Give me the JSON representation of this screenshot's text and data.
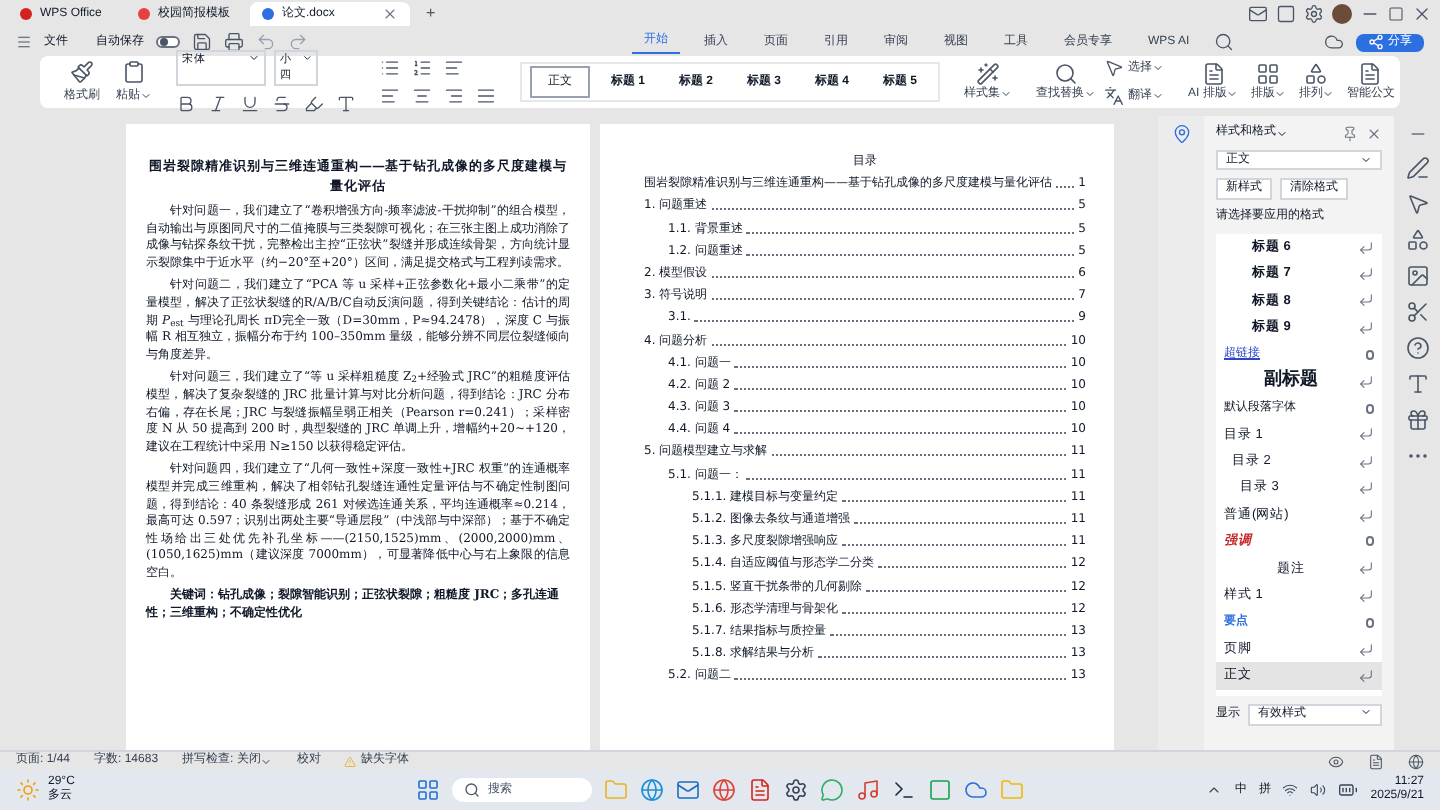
{
  "title_bar": {
    "tabs": [
      {
        "label": "WPS Office",
        "selected": false,
        "kind": "home"
      },
      {
        "label": "校园简报模板",
        "selected": false,
        "kind": "pdf"
      },
      {
        "label": "论文.docx",
        "selected": true,
        "kind": "doc"
      }
    ],
    "new_tab": "+"
  },
  "menu_bar": {
    "file": "文件",
    "autosave": {
      "label": "自动保存",
      "on": false
    },
    "tabs": [
      {
        "label": "开始",
        "selected": true
      },
      {
        "label": "插入",
        "selected": false
      },
      {
        "label": "页面",
        "selected": false
      },
      {
        "label": "引用",
        "selected": false
      },
      {
        "label": "审阅",
        "selected": false
      },
      {
        "label": "视图",
        "selected": false
      },
      {
        "label": "工具",
        "selected": false
      },
      {
        "label": "会员专享",
        "selected": false
      },
      {
        "label": "WPS AI",
        "selected": false
      }
    ],
    "share": "分享"
  },
  "ribbon": {
    "clipboard": [
      "格式刷",
      "粘贴"
    ],
    "font": {
      "name": "宋体",
      "size": "小四"
    },
    "styles": [
      {
        "label": "正文",
        "selected": true
      },
      {
        "label": "标题 1",
        "selected": false
      },
      {
        "label": "标题 2",
        "selected": false
      },
      {
        "label": "标题 3",
        "selected": false
      },
      {
        "label": "标题 4",
        "selected": false
      },
      {
        "label": "标题 5",
        "selected": false
      }
    ],
    "style_set": "样式集",
    "find": "查找替换",
    "select": "选择",
    "translate": "翻译",
    "tools": [
      "AI 排版",
      "排版",
      "排列"
    ],
    "smart_doc": "智能公文"
  },
  "page": {
    "title": "围岩裂隙精准识别与三维连通重构——基于钻孔成像的多尺度建模与量化评估",
    "paragraphs": [
      "针对问题一，我们建立了“卷积增强方向-频率滤波-干扰抑制”的组合模型，自动输出与原图同尺寸的二值掩膜与三类裂隙可视化；在三张主图上成功消除了成像与钻探条纹干扰，完整检出主控“正弦状”裂缝并形成连续骨架，方向统计显示裂隙集中于近水平（约−20°至+20°）区间，满足提交格式与工程判读需求。",
      "针对问题二，我们建立了“PCA 等 u 采样+正弦参数化+最小二乘带”的定量模型，解决了正弦状裂缝的R/A/B/C自动反演问题，得到关键结论：估计的周期 *P*$_{est}$ 与理论孔周长 πD完全一致（D=30mm，P≈94.2478），深度 C 与振幅 R 相互独立，振幅分布于约 100–350mm 量级，能够分辨不同层位裂缝倾向与角度差异。",
      "针对问题三，我们建立了“等 u 采样粗糙度 Z$_{2}$+经验式 JRC”的粗糙度评估模型，解决了复杂裂缝的 JRC 批量计算与对比分析问题，得到结论：JRC 分布右偏，存在长尾；JRC 与裂缝振幅呈弱正相关（Pearson r=0.241）；采样密度 N 从 50 提高到 200 时，典型裂缝的 JRC 单调上升，增幅约+20~+120，建议在工程统计中采用 N≥150 以获得稳定评估。",
      "针对问题四，我们建立了“几何一致性+深度一致性+JRC 权重”的连通概率模型并完成三维重构，解决了相邻钻孔裂缝连通性定量评估与不确定性制图问题，得到结论：40 条裂缝形成 261 对候选连通关系，平均连通概率≈0.214，最高可达 0.597；识别出两处主要“导通层段”（中浅部与中深部）；基于不确定性场给出三处优先补孔坐标——(2150,1525)mm、(2000,2000)mm、(1050,1625)mm（建议深度 7000mm），可显著降低中心与右上象限的信息空白。"
    ],
    "keywords": "关键词：钻孔成像；裂隙智能识别；正弦状裂隙；粗糙度 JRC；多孔连通性；三维重构；不确定性优化"
  },
  "toc": {
    "title": "目录",
    "entries": [
      {
        "text": "围岩裂隙精准识别与三维连通重构——基于钻孔成像的多尺度建模与量化评估",
        "page": "1"
      },
      {
        "text": "1. 问题重述",
        "page": "5",
        "children": [
          {
            "text": "1.1. 背景重述",
            "page": "5"
          },
          {
            "text": "1.2. 问题重述",
            "page": "5"
          }
        ]
      },
      {
        "text": "2. 模型假设",
        "page": "6"
      },
      {
        "text": "3. 符号说明",
        "page": "7",
        "children": [
          {
            "text": "3.1.",
            "page": "9"
          }
        ]
      },
      {
        "text": "4. 问题分析",
        "page": "10",
        "children": [
          {
            "text": "4.1. 问题一",
            "page": "10"
          },
          {
            "text": "4.2. 问题 2",
            "page": "10"
          },
          {
            "text": "4.3. 问题 3",
            "page": "10"
          },
          {
            "text": "4.4. 问题 4",
            "page": "10"
          }
        ]
      },
      {
        "text": "5. 问题模型建立与求解",
        "page": "11",
        "children": [
          {
            "text": "5.1. 问题一：",
            "page": "11",
            "children": [
              {
                "text": "5.1.1. 建模目标与变量约定",
                "page": "11"
              },
              {
                "text": "5.1.2. 图像去条纹与通道增强",
                "page": "11"
              },
              {
                "text": "5.1.3. 多尺度裂隙增强响应",
                "page": "11"
              },
              {
                "text": "5.1.4. 自适应阈值与形态学二分类",
                "page": "12"
              },
              {
                "text": "5.1.5. 竖直干扰条带的几何剔除",
                "page": "12"
              },
              {
                "text": "5.1.6. 形态学清理与骨架化",
                "page": "12"
              },
              {
                "text": "5.1.7. 结果指标与质控量",
                "page": "13"
              },
              {
                "text": "5.1.8. 求解结果与分析",
                "page": "13"
              }
            ]
          },
          {
            "text": "5.2. 问题二",
            "page": "13"
          }
        ]
      }
    ]
  },
  "styles_pane": {
    "title": "样式和格式",
    "current": "正文",
    "buttons": [
      "新样式",
      "清除格式"
    ],
    "prompt": "请选择要应用的格式",
    "styles": [
      {
        "label": "标题 6",
        "kind": "heading",
        "selected": false
      },
      {
        "label": "标题 7",
        "kind": "heading",
        "selected": false
      },
      {
        "label": "标题 8",
        "kind": "heading",
        "selected": false
      },
      {
        "label": "标题 9",
        "kind": "heading",
        "selected": false
      },
      {
        "label": "超链接",
        "kind": "link",
        "selected": false
      },
      {
        "label": "副标题",
        "kind": "subtitle",
        "selected": false
      },
      {
        "label": "默认段落字体",
        "kind": "character",
        "selected": false
      },
      {
        "label": "目录 1",
        "kind": "toc1",
        "selected": false
      },
      {
        "label": "目录 2",
        "kind": "toc2",
        "selected": false
      },
      {
        "label": "目录 3",
        "kind": "toc3",
        "selected": false
      },
      {
        "label": "普通(网站)",
        "kind": "plain",
        "selected": false
      },
      {
        "label": "强调",
        "kind": "emphasis",
        "selected": false
      },
      {
        "label": "题注",
        "kind": "caption",
        "selected": false
      },
      {
        "label": "样式 1",
        "kind": "plain",
        "selected": false
      },
      {
        "label": "要点",
        "kind": "strong",
        "selected": false
      },
      {
        "label": "页脚",
        "kind": "plain",
        "selected": false
      },
      {
        "label": "正文",
        "kind": "plain",
        "selected": true
      }
    ],
    "show_label": "显示",
    "show_value": "有效样式"
  },
  "status_bar": {
    "page": "页面: 1/44",
    "words": "字数: 14683",
    "spell": "拼写检查: 关闭",
    "proof": "校对",
    "missing_fonts": "缺失字体"
  },
  "taskbar": {
    "temperature": "29°C",
    "weather": "多云",
    "search": "搜索",
    "ime": "中",
    "ime_mode": "拼",
    "time": "11:27",
    "date": "2025/9/21"
  }
}
